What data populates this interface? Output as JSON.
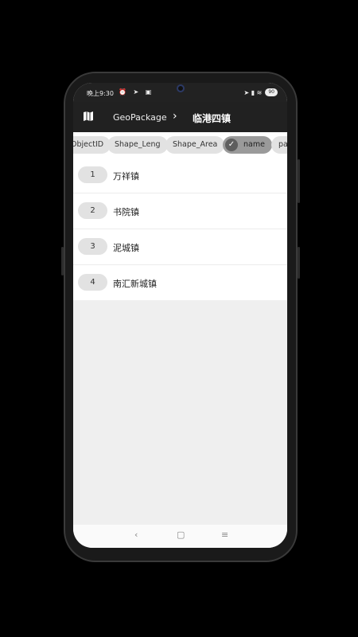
{
  "status_bar": {
    "time": "晚上9:30",
    "left_icons": "⏰ ➤ ▣",
    "right_icons": "➤ ▮ ≋",
    "battery": "90"
  },
  "toolbar": {
    "icon": "map-icon",
    "breadcrumb_root": "GeoPackage",
    "breadcrumb_separator": "›",
    "breadcrumb_current": "临港四镇"
  },
  "column_chips": [
    {
      "label": "ObjectID",
      "selected": false
    },
    {
      "label": "Shape_Leng",
      "selected": false
    },
    {
      "label": "Shape_Area",
      "selected": false
    },
    {
      "label": "name",
      "selected": true
    },
    {
      "label": "pac",
      "selected": false
    }
  ],
  "rows": [
    {
      "index": "1",
      "name": "万祥镇"
    },
    {
      "index": "2",
      "name": "书院镇"
    },
    {
      "index": "3",
      "name": "泥城镇"
    },
    {
      "index": "4",
      "name": "南汇新城镇"
    }
  ],
  "nav_bar": {
    "back": "‹",
    "home": "▢",
    "menu": "≡"
  }
}
